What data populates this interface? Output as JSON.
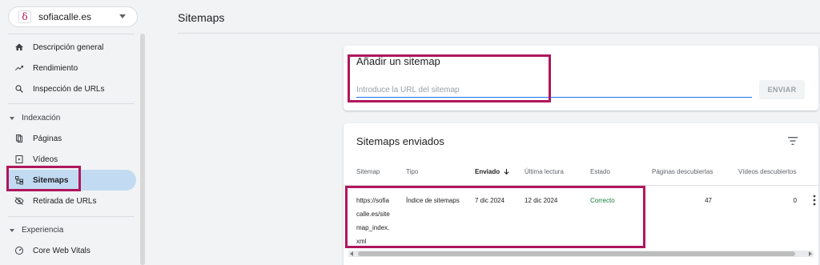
{
  "property": {
    "logo": "δ",
    "name": "sofiacalle.es"
  },
  "nav": {
    "overview": "Descripción general",
    "performance": "Rendimiento",
    "url_inspection": "Inspección de URLs",
    "indexing_section": "Indexación",
    "pages": "Páginas",
    "videos": "Vídeos",
    "sitemaps": "Sitemaps",
    "removals": "Retirada de URLs",
    "experience_section": "Experiencia",
    "cwv": "Core Web Vitals"
  },
  "header": {
    "title": "Sitemaps"
  },
  "add_sitemap": {
    "title": "Añadir un sitemap",
    "placeholder": "Introduce la URL del sitemap",
    "value": "",
    "button": "ENVIAR"
  },
  "submitted": {
    "title": "Sitemaps enviados",
    "columns": {
      "sitemap": "Sitemap",
      "type": "Tipo",
      "submitted": "Enviado",
      "last_read": "Última lectura",
      "status": "Estado",
      "pages": "Páginas descubiertas",
      "videos": "Vídeos descubiertos"
    },
    "rows": [
      {
        "sitemap_lines": [
          "https://sofia",
          "calle.es/site",
          "map_index.",
          "xml"
        ],
        "type": "Índice de sitemaps",
        "submitted": "7 dic 2024",
        "last_read": "12 dic 2024",
        "status": "Correcto",
        "pages": "47",
        "videos": "0"
      }
    ]
  },
  "colors": {
    "highlight": "#b0165d",
    "active_nav": "#c2dbf2",
    "status_ok": "#188038",
    "input_underline": "#1a73e8"
  }
}
